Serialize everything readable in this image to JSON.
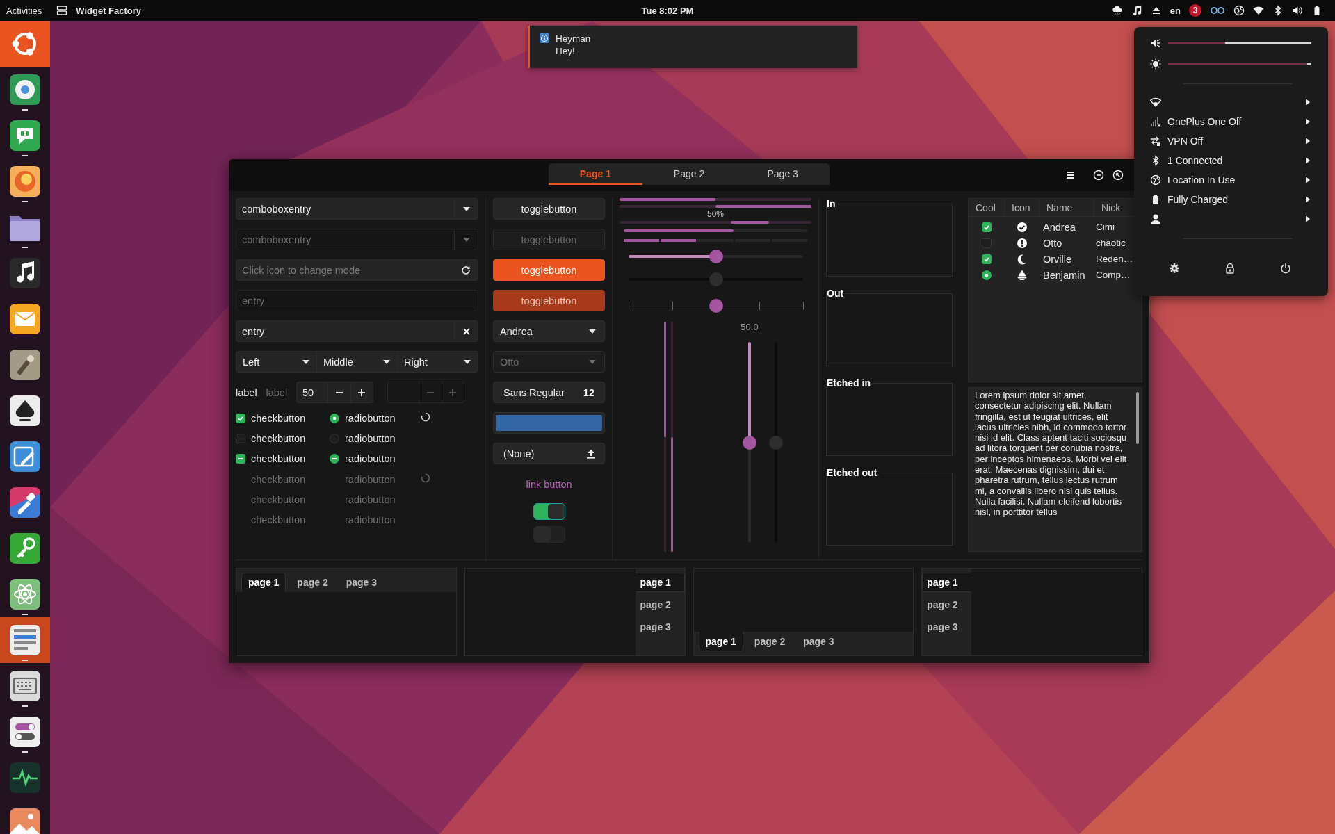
{
  "top_bar": {
    "activities": "Activities",
    "app_name": "Widget Factory",
    "clock": "Tue 8:02 PM",
    "keyboard": "en",
    "notification_count": "3"
  },
  "dock": {
    "items": [
      {
        "running": false,
        "focused": false
      },
      {
        "running": true,
        "focused": false
      },
      {
        "running": true,
        "focused": false
      },
      {
        "running": true,
        "focused": false
      },
      {
        "running": true,
        "focused": false
      },
      {
        "running": false,
        "focused": false
      },
      {
        "running": false,
        "focused": false
      },
      {
        "running": false,
        "focused": false
      },
      {
        "running": false,
        "focused": false
      },
      {
        "running": false,
        "focused": false
      },
      {
        "running": false,
        "focused": false
      },
      {
        "running": false,
        "focused": false
      },
      {
        "running": true,
        "focused": false
      },
      {
        "running": true,
        "focused": true
      },
      {
        "running": true,
        "focused": false
      },
      {
        "running": true,
        "focused": false
      },
      {
        "running": false,
        "focused": false
      },
      {
        "focused": false
      }
    ]
  },
  "notification": {
    "title": "Heyman",
    "body": "Hey!"
  },
  "window": {
    "tabs": [
      {
        "label": "Page 1",
        "selected": true
      },
      {
        "label": "Page 2",
        "selected": false
      },
      {
        "label": "Page 3",
        "selected": false
      }
    ],
    "column_1": {
      "fields": [
        {
          "kind": "combo",
          "value": "comboboxentry",
          "disabled": false
        },
        {
          "kind": "combo",
          "value": "comboboxentry",
          "disabled": true
        },
        {
          "kind": "mode-entry",
          "placeholder": "Click icon to change mode",
          "disabled": false
        },
        {
          "kind": "entry",
          "value": "entry",
          "disabled": true
        },
        {
          "kind": "clear-entry",
          "value": "entry",
          "disabled": false
        }
      ],
      "segmented_combo": [
        "Left",
        "Middle",
        "Right"
      ],
      "labels": [
        {
          "text": "label",
          "disabled": false
        },
        {
          "text": "label",
          "disabled": true
        }
      ],
      "spin_buttons": [
        {
          "value": "50",
          "disabled": false
        },
        {
          "disabled": true
        }
      ],
      "check_rows": [
        {
          "check": {
            "label": "checkbutton",
            "checked": true,
            "disabled": false
          },
          "radio": {
            "label": "radiobutton",
            "checked": true,
            "disabled": false
          },
          "spinner": {
            "disabled": false
          }
        },
        {
          "check": {
            "label": "checkbutton",
            "checked": false,
            "disabled": false
          },
          "radio": {
            "label": "radiobutton",
            "checked": false,
            "disabled": false
          }
        },
        {
          "check": {
            "label": "checkbutton",
            "mixed": true,
            "disabled": false
          },
          "radio": {
            "label": "radiobutton",
            "mixed": true,
            "disabled": false
          }
        },
        {
          "check": {
            "label": "checkbutton",
            "disabled": true
          },
          "radio": {
            "label": "radiobutton",
            "disabled": true
          },
          "spinner": {
            "disabled": true
          }
        },
        {
          "check": {
            "label": "checkbutton",
            "disabled": true
          },
          "radio": {
            "label": "radiobutton",
            "disabled": true
          }
        },
        {
          "check": {
            "label": "checkbutton",
            "disabled": true
          },
          "radio": {
            "label": "radiobutton",
            "disabled": true
          }
        }
      ]
    },
    "column_2": {
      "toggle_buttons": [
        {
          "label": "togglebutton",
          "active": false,
          "disabled": false
        },
        {
          "label": "togglebutton",
          "active": false,
          "disabled": true
        },
        {
          "label": "togglebutton",
          "active": true,
          "disabled": false
        },
        {
          "label": "togglebutton",
          "active": true,
          "disabled": true
        }
      ],
      "combos": [
        {
          "value": "Andrea",
          "disabled": false
        },
        {
          "value": "Otto",
          "disabled": true
        }
      ],
      "font_button": {
        "family": "Sans Regular",
        "size": "12"
      },
      "color_button": {
        "color": "#3465a4"
      },
      "file_button": {
        "label": "(None)"
      },
      "link_button": {
        "label": "link button"
      },
      "switches": [
        {
          "on": true,
          "disabled": false
        },
        {
          "on": false,
          "disabled": true
        }
      ]
    },
    "column_3": {
      "progress_bars": [
        {
          "kind": "bar",
          "level": 0.5
        },
        {
          "kind": "inverted",
          "level": 0.5
        },
        {
          "kind": "pulse",
          "text": "50%"
        },
        {
          "kind": "level",
          "level": 0.6
        },
        {
          "kind": "segmented",
          "level": 0.4
        }
      ],
      "sliders": [
        {
          "kind": "plain",
          "level": 0.5,
          "disabled": false
        },
        {
          "kind": "plain",
          "level": 0.5,
          "disabled": true
        },
        {
          "kind": "marks",
          "level": 0.5,
          "disabled": false
        }
      ],
      "vertical_bars": [
        {
          "kind": "bar",
          "level": 0.5
        },
        {
          "kind": "inverted",
          "level": 0.5
        }
      ],
      "vertical_sliders": [
        {
          "value": "50.0",
          "level": 0.5,
          "disabled": false
        },
        {
          "level": 0.5,
          "disabled": true
        }
      ]
    },
    "column_4": {
      "frames": [
        {
          "label": "In"
        },
        {
          "label": "Out"
        },
        {
          "label": "Etched in"
        },
        {
          "label": "Etched out"
        }
      ]
    },
    "column_5": {
      "tree": {
        "columns": [
          "Cool",
          "Icon",
          "Name",
          "Nick"
        ],
        "rows": [
          {
            "kind": "check",
            "checked": true,
            "name": "Andrea",
            "nick": "Cimi"
          },
          {
            "kind": "check",
            "checked": false,
            "name": "Otto",
            "nick": "chaotic"
          },
          {
            "kind": "check",
            "checked": true,
            "name": "Orville",
            "nick": "Reden…"
          },
          {
            "kind": "radio",
            "checked": true,
            "name": "Benjamin",
            "nick": "Comp…"
          }
        ]
      },
      "text_view": "Lorem ipsum dolor sit amet, consectetur adipiscing elit. Nullam fringilla, est ut feugiat ultrices, elit lacus ultricies nibh, id commodo tortor nisi id elit. Class aptent taciti sociosqu ad litora torquent per conubia nostra, per inceptos himenaeos. Morbi vel elit erat. Maecenas dignissim, dui et pharetra rutrum, tellus lectus rutrum mi, a convallis libero nisi quis tellus. Nulla facilisi. Nullam eleifend lobortis nisl, in porttitor tellus"
    },
    "notebooks": [
      {
        "kind": "top",
        "tabs": [
          {
            "label": "page 1",
            "selected": true
          },
          {
            "label": "page 2",
            "selected": false
          },
          {
            "label": "page 3",
            "selected": false
          }
        ]
      },
      {
        "kind": "right",
        "tabs": [
          {
            "label": "page 1",
            "selected": true
          },
          {
            "label": "page 2",
            "selected": false
          },
          {
            "label": "page 3",
            "selected": false
          }
        ]
      },
      {
        "kind": "bottom",
        "tabs": [
          {
            "label": "page 1",
            "selected": true
          },
          {
            "label": "page 2",
            "selected": false
          },
          {
            "label": "page 3",
            "selected": false
          }
        ]
      },
      {
        "kind": "left",
        "tabs": [
          {
            "label": "page 1",
            "selected": true
          },
          {
            "label": "page 2",
            "selected": false
          },
          {
            "label": "page 3",
            "selected": false
          }
        ]
      }
    ]
  },
  "system_menu": {
    "sliders": [
      {
        "level": 0.4
      },
      {
        "level": 0.97
      }
    ],
    "items": [
      {
        "submenu": true
      },
      {
        "label": "OnePlus One Off",
        "submenu": true
      },
      {
        "label": "VPN Off",
        "submenu": true
      },
      {
        "label": "1 Connected",
        "submenu": true
      },
      {
        "label": "Location In Use",
        "submenu": true
      },
      {
        "label": "Fully Charged",
        "submenu": true
      },
      {
        "submenu": true
      }
    ]
  }
}
